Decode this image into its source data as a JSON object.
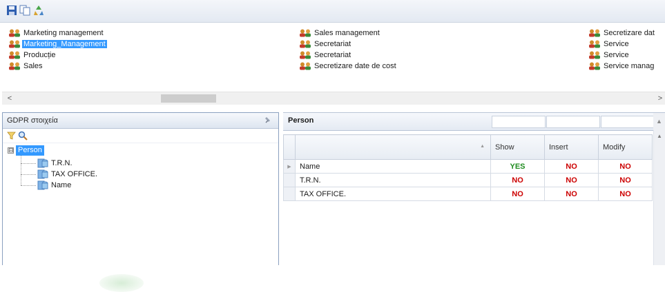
{
  "toolbar": {
    "icons": [
      "save-icon",
      "copy-icon",
      "recycle-icon"
    ]
  },
  "roles": {
    "columns": [
      [
        "Marketing management",
        "Marketing_Management",
        "Producție",
        "Sales"
      ],
      [
        "Sales management",
        "Secretariat",
        "Secretariat",
        "Secretizare date de cost"
      ],
      [
        "Secretizare dat",
        "Service",
        "Service",
        "Service manag"
      ]
    ],
    "selected": "Marketing_Management"
  },
  "scroll": {
    "left_arrow": "<",
    "right_arrow": ">"
  },
  "left_panel": {
    "title": "GDPR στοιχεία",
    "tree": {
      "expander": "⊟",
      "root": "Person",
      "children": [
        "T.R.N.",
        "TAX OFFICE.",
        "Name"
      ]
    }
  },
  "right_panel": {
    "title": "Person",
    "columns": [
      "",
      "Show",
      "Insert",
      "Modify"
    ],
    "rows": [
      {
        "field": "Name",
        "show": "YES",
        "insert": "NO",
        "modify": "NO"
      },
      {
        "field": "T.R.N.",
        "show": "NO",
        "insert": "NO",
        "modify": "NO"
      },
      {
        "field": "TAX OFFICE.",
        "show": "NO",
        "insert": "NO",
        "modify": "NO"
      }
    ]
  },
  "colors": {
    "selection": "#3399ff",
    "yes": "#1f8c1f",
    "no": "#cc0000"
  }
}
